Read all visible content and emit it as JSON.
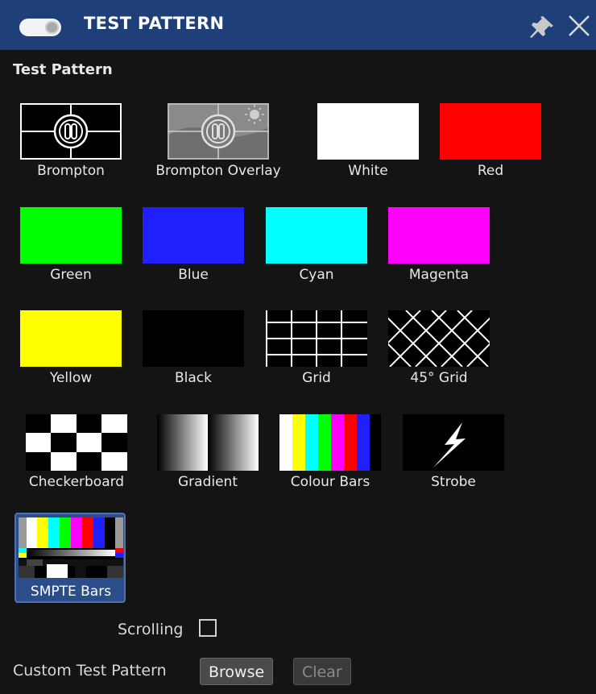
{
  "window": {
    "title": "TEST PATTERN",
    "toggle_on": true,
    "colors": {
      "titlebar": "#1f3f78",
      "background": "#141414",
      "selected": "#2b4d89"
    }
  },
  "section": {
    "title": "Test Pattern"
  },
  "patterns": [
    {
      "label": "Brompton",
      "icon": "brompton-logo-pattern"
    },
    {
      "label": "Brompton Overlay",
      "icon": "brompton-overlay-pattern"
    },
    {
      "label": "White",
      "color": "#ffffff"
    },
    {
      "label": "Red",
      "color": "#ff0000"
    },
    {
      "label": "Green",
      "color": "#00ff00"
    },
    {
      "label": "Blue",
      "color": "#2020ff"
    },
    {
      "label": "Cyan",
      "color": "#00ffff"
    },
    {
      "label": "Magenta",
      "color": "#ff00ff"
    },
    {
      "label": "Yellow",
      "color": "#ffff00"
    },
    {
      "label": "Black",
      "color": "#000000"
    },
    {
      "label": "Grid",
      "icon": "grid-pattern"
    },
    {
      "label": "45° Grid",
      "icon": "diagonal-grid-pattern"
    },
    {
      "label": "Checkerboard",
      "icon": "checkerboard-pattern"
    },
    {
      "label": "Gradient",
      "icon": "gradient-pattern"
    },
    {
      "label": "Colour Bars",
      "icon": "colour-bars-pattern"
    },
    {
      "label": "Strobe",
      "icon": "lightning-icon"
    },
    {
      "label": "SMPTE Bars",
      "icon": "smpte-bars-pattern",
      "selected": true
    }
  ],
  "scrolling": {
    "label": "Scrolling",
    "checked": false
  },
  "custom": {
    "label": "Custom Test Pattern",
    "browse_label": "Browse",
    "clear_label": "Clear",
    "clear_enabled": false
  }
}
